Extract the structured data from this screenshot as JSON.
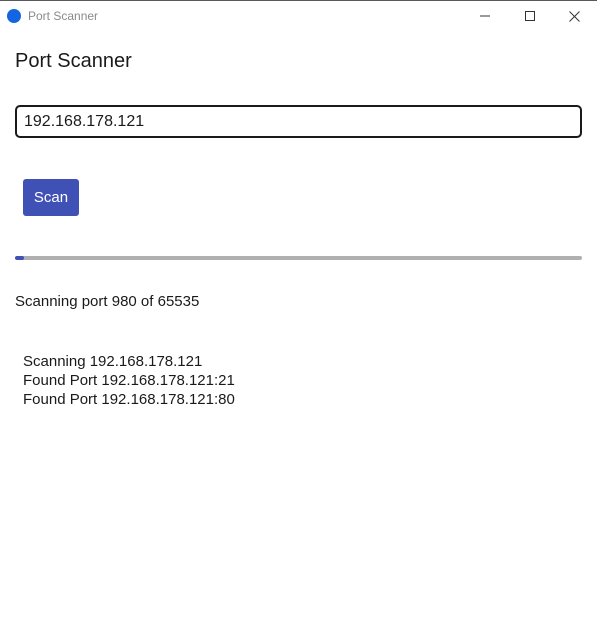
{
  "window": {
    "title": "Port Scanner",
    "icon": "app-circle-icon",
    "accent_color": "#1565e0",
    "controls": {
      "minimize_icon": "minimize-icon",
      "maximize_icon": "maximize-icon",
      "close_icon": "close-icon"
    }
  },
  "main": {
    "heading": "Port Scanner",
    "ip_field": {
      "value": "192.168.178.121",
      "placeholder": ""
    },
    "scan_button": {
      "label": "Scan",
      "color": "#3f51b5"
    },
    "progress": {
      "current_port": 980,
      "total_ports": 65535,
      "fraction": 0.015,
      "fill_color": "#3f51b5",
      "track_color": "#b0b0b0"
    },
    "status": "Scanning port 980 of 65535",
    "log": [
      "Scanning 192.168.178.121",
      "Found Port 192.168.178.121:21",
      "Found Port 192.168.178.121:80"
    ]
  }
}
